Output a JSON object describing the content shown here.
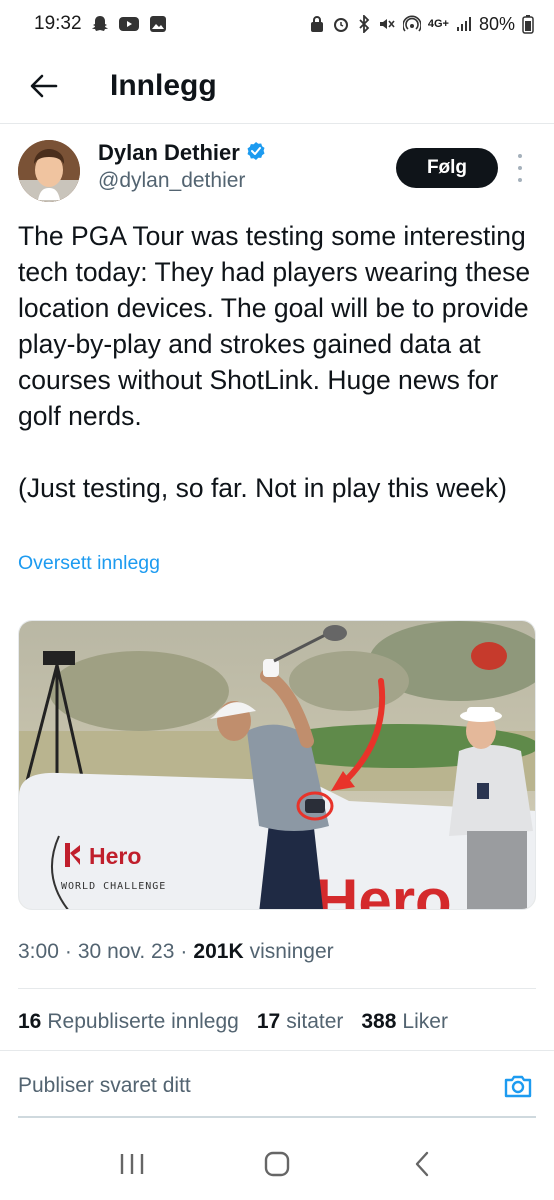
{
  "status_bar": {
    "time": "19:32",
    "battery": "80%",
    "network": "4G+"
  },
  "header": {
    "title": "Innlegg"
  },
  "post": {
    "author_name": "Dylan Dethier",
    "author_handle": "@dylan_dethier",
    "verified": true,
    "follow_label": "Følg",
    "text": "The PGA Tour was testing some interesting tech today: They had players wearing these location devices. The goal will be to provide play-by-play and strokes gained data at courses without ShotLink. Huge news for golf nerds.\n\n(Just testing, so far. Not in play this week)",
    "translate_label": "Oversett innlegg",
    "image_sign_text": "Hero",
    "image_sign_subtext": "WORLD CHALLENGE",
    "image_big_text": "Hero"
  },
  "meta": {
    "time": "3:00",
    "sep1": "·",
    "date": "30 nov. 23",
    "sep2": "·",
    "views_count": "201K",
    "views_label": "visninger"
  },
  "stats": {
    "reposts_count": "16",
    "reposts_label": "Republiserte innlegg",
    "quotes_count": "17",
    "quotes_label": "sitater",
    "likes_count": "388",
    "likes_label": "Liker"
  },
  "reply": {
    "placeholder": "Publiser svaret ditt"
  },
  "colors": {
    "accent": "#1d9bf0",
    "text_primary": "#0f1419",
    "text_secondary": "#536471",
    "follow_bg": "#0f1419",
    "annotation_red": "#e8332a"
  }
}
